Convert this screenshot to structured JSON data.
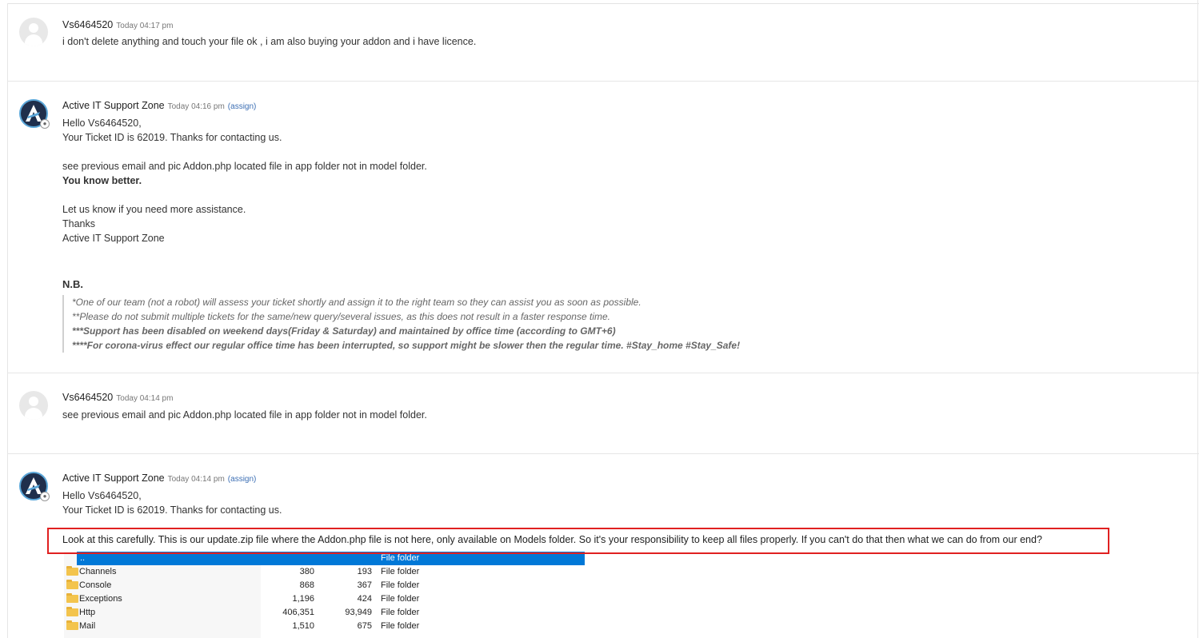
{
  "messages": [
    {
      "author": "Vs6464520",
      "time": "Today 04:17 pm",
      "body": [
        "i don't delete anything and touch your file ok , i am also buying your addon and i have licence."
      ]
    },
    {
      "author": "Active IT Support Zone",
      "time": "Today 04:16 pm",
      "assign": "(assign)",
      "greeting": "Hello Vs6464520,",
      "ticket": "Your Ticket ID is 62019. Thanks for contacting us.",
      "body1": "see previous email and pic Addon.php located file in app folder not in model folder.",
      "body2": "You know better.",
      "body3": "Let us know if you need more assistance.",
      "body4": "Thanks",
      "body5": "Active IT Support Zone",
      "nb_title": "N.B.",
      "notes": [
        "*One of our team (not a robot) will assess your ticket shortly and assign it to the right team so they can assist you as soon as possible.",
        "**Please do not submit multiple tickets for the same/new query/several issues, as this does not result in a faster response time.",
        "***Support has been disabled on weekend days(Friday & Saturday) and maintained by office time (according to GMT+6)",
        "****For corona-virus effect our regular office time has been interrupted, so support might be slower then the regular time. #Stay_home #Stay_Safe!"
      ]
    },
    {
      "author": "Vs6464520",
      "time": "Today 04:14 pm",
      "body": [
        "see previous email and pic Addon.php located file in app folder not in model folder."
      ]
    },
    {
      "author": "Active IT Support Zone",
      "time": "Today 04:14 pm",
      "assign": "(assign)",
      "greeting": "Hello Vs6464520,",
      "ticket": "Your Ticket ID is 62019. Thanks for contacting us.",
      "highlight": "Look at this carefully. This is our update.zip file where the Addon.php file is not here, only available on Models folder. So it's your responsibility to keep all files properly. If you can't do that then what we can do from our end?"
    }
  ],
  "explorer": {
    "rows": [
      {
        "name": "..",
        "size": "",
        "packed": "",
        "type": "File folder",
        "selected": true
      },
      {
        "name": "Channels",
        "size": "380",
        "packed": "193",
        "type": "File folder"
      },
      {
        "name": "Console",
        "size": "868",
        "packed": "367",
        "type": "File folder"
      },
      {
        "name": "Exceptions",
        "size": "1,196",
        "packed": "424",
        "type": "File folder"
      },
      {
        "name": "Http",
        "size": "406,351",
        "packed": "93,949",
        "type": "File folder"
      },
      {
        "name": "Mail",
        "size": "1,510",
        "packed": "675",
        "type": "File folder"
      }
    ]
  },
  "colors": {
    "accent_link": "#3c6fb4",
    "highlight_border": "#e02020",
    "selection": "#0078d7"
  }
}
